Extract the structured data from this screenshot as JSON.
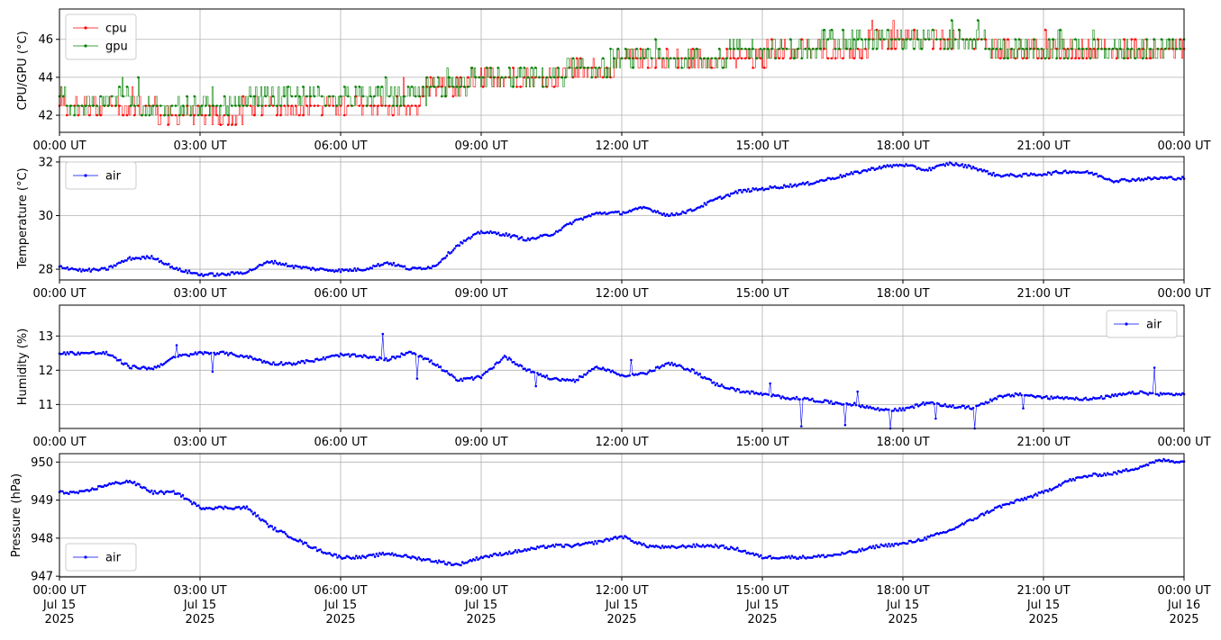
{
  "figure": {
    "timezone_suffix": "UT",
    "x_ticks": [
      "00:00 UT",
      "03:00 UT",
      "06:00 UT",
      "09:00 UT",
      "12:00 UT",
      "15:00 UT",
      "18:00 UT",
      "21:00 UT",
      "00:00 UT"
    ],
    "x_ticks_bottom_line2": [
      "Jul 15",
      "Jul 15",
      "Jul 15",
      "Jul 15",
      "Jul 15",
      "Jul 15",
      "Jul 15",
      "Jul 15",
      "Jul 16"
    ],
    "x_ticks_bottom_line3": [
      "2025",
      "2025",
      "2025",
      "2025",
      "2025",
      "2025",
      "2025",
      "2025",
      "2025"
    ]
  },
  "chart_data": [
    {
      "type": "line",
      "ylabel": "CPU/GPU (°C)",
      "xlim": [
        "2025-07-15 00:00",
        "2025-07-16 00:00"
      ],
      "ylim": [
        41.1,
        47.6
      ],
      "yticks": [
        42,
        44,
        46
      ],
      "grid": true,
      "legend": "top-left",
      "x_hours": [
        0,
        0.5,
        1,
        1.5,
        2,
        2.5,
        3,
        3.5,
        4,
        4.5,
        5,
        5.5,
        6,
        6.5,
        7,
        7.5,
        8,
        8.5,
        9,
        9.5,
        10,
        10.5,
        11,
        11.5,
        12,
        12.5,
        13,
        13.5,
        14,
        14.5,
        15,
        15.5,
        16,
        16.5,
        17,
        17.5,
        18,
        18.5,
        19,
        19.5,
        20,
        20.5,
        21,
        21.5,
        22,
        22.5,
        23,
        23.5,
        24
      ],
      "series": [
        {
          "name": "cpu",
          "color": "#ff0000",
          "values": [
            42.3,
            42.3,
            42.3,
            42.3,
            42.3,
            42.0,
            42.0,
            42.0,
            42.3,
            42.3,
            42.3,
            42.3,
            42.3,
            42.3,
            42.3,
            42.3,
            43.5,
            43.5,
            44.0,
            44.0,
            44.0,
            44.0,
            44.5,
            44.5,
            44.8,
            45.0,
            45.0,
            45.0,
            45.0,
            45.2,
            45.2,
            45.5,
            45.5,
            45.5,
            45.5,
            46.0,
            46.0,
            46.0,
            46.0,
            46.0,
            45.5,
            45.5,
            45.5,
            45.5,
            45.5,
            45.5,
            45.5,
            45.5,
            45.5
          ]
        },
        {
          "name": "gpu",
          "color": "#008000",
          "values": [
            42.8,
            42.6,
            42.8,
            42.8,
            42.3,
            42.3,
            42.3,
            42.3,
            42.8,
            42.8,
            42.8,
            42.8,
            42.8,
            42.8,
            42.8,
            42.8,
            43.5,
            43.5,
            44.0,
            44.0,
            44.0,
            44.0,
            44.5,
            44.5,
            45.0,
            45.0,
            45.0,
            45.0,
            45.0,
            45.5,
            45.5,
            45.5,
            45.5,
            46.0,
            46.0,
            46.0,
            46.0,
            46.0,
            46.0,
            46.0,
            45.5,
            45.5,
            45.5,
            45.5,
            45.5,
            45.5,
            45.5,
            45.5,
            45.5
          ]
        }
      ]
    },
    {
      "type": "line",
      "ylabel": "Temperature (°C)",
      "xlim": [
        "2025-07-15 00:00",
        "2025-07-16 00:00"
      ],
      "ylim": [
        27.6,
        32.2
      ],
      "yticks": [
        28,
        30,
        32
      ],
      "grid": true,
      "legend": "top-left",
      "x_hours": [
        0,
        0.5,
        1,
        1.5,
        2,
        2.5,
        3,
        3.5,
        4,
        4.5,
        5,
        5.5,
        6,
        6.5,
        7,
        7.5,
        8,
        8.5,
        9,
        9.5,
        10,
        10.5,
        11,
        11.5,
        12,
        12.5,
        13,
        13.5,
        14,
        14.5,
        15,
        15.5,
        16,
        16.5,
        17,
        17.5,
        18,
        18.5,
        19,
        19.5,
        20,
        20.5,
        21,
        21.5,
        22,
        22.5,
        23,
        23.5,
        24
      ],
      "series": [
        {
          "name": "air",
          "color": "#0000ff",
          "values": [
            28.1,
            27.95,
            28.0,
            28.4,
            28.45,
            28.0,
            27.8,
            27.8,
            27.9,
            28.3,
            28.1,
            28.0,
            27.95,
            28.0,
            28.25,
            28.0,
            28.1,
            28.9,
            29.4,
            29.3,
            29.1,
            29.3,
            29.8,
            30.1,
            30.1,
            30.3,
            30.0,
            30.2,
            30.6,
            30.9,
            31.0,
            31.1,
            31.2,
            31.4,
            31.6,
            31.8,
            31.9,
            31.7,
            31.95,
            31.8,
            31.5,
            31.5,
            31.55,
            31.65,
            31.6,
            31.3,
            31.35,
            31.4,
            31.4
          ]
        }
      ]
    },
    {
      "type": "line",
      "ylabel": "Humidity (%)",
      "xlim": [
        "2025-07-15 00:00",
        "2025-07-16 00:00"
      ],
      "ylim": [
        10.3,
        13.9
      ],
      "yticks": [
        11,
        12,
        13
      ],
      "grid": true,
      "legend": "top-right",
      "x_hours": [
        0,
        0.5,
        1,
        1.5,
        2,
        2.5,
        3,
        3.5,
        4,
        4.5,
        5,
        5.5,
        6,
        6.5,
        7,
        7.5,
        8,
        8.5,
        9,
        9.5,
        10,
        10.5,
        11,
        11.5,
        12,
        12.5,
        13,
        13.5,
        14,
        14.5,
        15,
        15.5,
        16,
        16.5,
        17,
        17.5,
        18,
        18.5,
        19,
        19.5,
        20,
        20.5,
        21,
        21.5,
        22,
        22.5,
        23,
        23.5,
        24
      ],
      "series": [
        {
          "name": "air",
          "color": "#0000ff",
          "values": [
            12.5,
            12.5,
            12.5,
            12.1,
            12.05,
            12.4,
            12.5,
            12.5,
            12.4,
            12.2,
            12.2,
            12.3,
            12.45,
            12.4,
            12.3,
            12.55,
            12.2,
            11.7,
            11.8,
            12.4,
            12.0,
            11.75,
            11.7,
            12.1,
            11.85,
            11.9,
            12.2,
            12.0,
            11.6,
            11.4,
            11.3,
            11.2,
            11.15,
            11.05,
            11.0,
            10.85,
            10.85,
            11.05,
            10.95,
            10.9,
            11.2,
            11.3,
            11.2,
            11.2,
            11.15,
            11.25,
            11.35,
            11.3,
            11.3
          ]
        }
      ]
    },
    {
      "type": "line",
      "ylabel": "Pressure (hPa)",
      "xlim": [
        "2025-07-15 00:00",
        "2025-07-16 00:00"
      ],
      "ylim": [
        946.98,
        950.22
      ],
      "yticks": [
        947,
        948,
        949,
        950
      ],
      "grid": true,
      "legend": "bottom-left",
      "x_hours": [
        0,
        0.5,
        1,
        1.5,
        2,
        2.5,
        3,
        3.5,
        4,
        4.5,
        5,
        5.5,
        6,
        6.5,
        7,
        7.5,
        8,
        8.5,
        9,
        9.5,
        10,
        10.5,
        11,
        11.5,
        12,
        12.5,
        13,
        13.5,
        14,
        14.5,
        15,
        15.5,
        16,
        16.5,
        17,
        17.5,
        18,
        18.5,
        19,
        19.5,
        20,
        20.5,
        21,
        21.5,
        22,
        22.5,
        23,
        23.5,
        24
      ],
      "series": [
        {
          "name": "air",
          "color": "#0000ff",
          "values": [
            949.2,
            949.2,
            949.4,
            949.5,
            949.2,
            949.2,
            948.8,
            948.8,
            948.8,
            948.3,
            948.0,
            947.7,
            947.5,
            947.5,
            947.6,
            947.5,
            947.4,
            947.3,
            947.5,
            947.6,
            947.7,
            947.8,
            947.8,
            947.9,
            948.05,
            947.8,
            947.75,
            947.8,
            947.8,
            947.7,
            947.5,
            947.5,
            947.5,
            947.55,
            947.65,
            947.8,
            947.85,
            948.0,
            948.2,
            948.5,
            948.8,
            949.0,
            949.2,
            949.5,
            949.65,
            949.7,
            949.85,
            950.05,
            950.0
          ]
        }
      ]
    }
  ]
}
